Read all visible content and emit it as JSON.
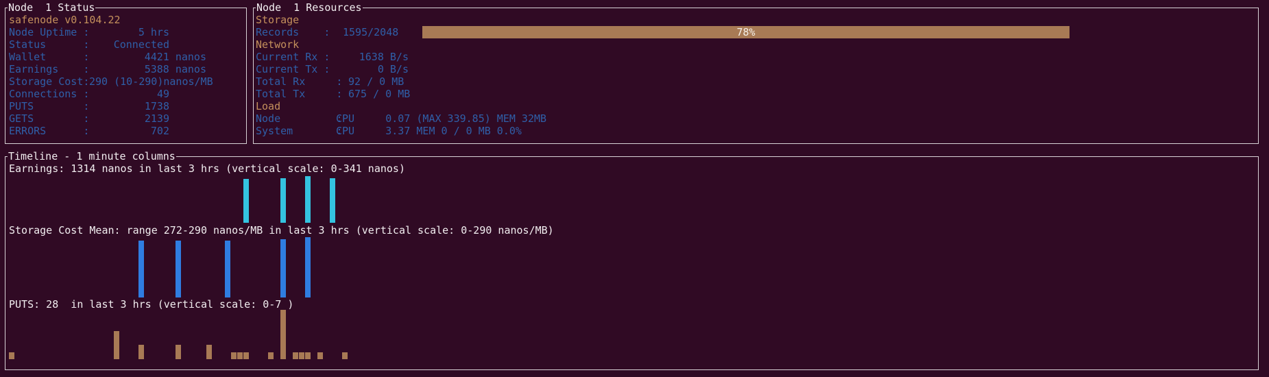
{
  "status_panel": {
    "title": "Node  1 Status",
    "version": "safenode v0.104.22",
    "rows": [
      {
        "label": "Node Uptime :",
        "value": "5 hrs"
      },
      {
        "label": "Status      :",
        "value": "Connected"
      },
      {
        "label": "Wallet      :",
        "value": "4421 nanos"
      },
      {
        "label": "Earnings    :",
        "value": "5388 nanos"
      },
      {
        "label": "Storage Cost:",
        "value": "290 (10-290)nanos/MB"
      },
      {
        "label": "Connections :",
        "value": "49"
      },
      {
        "label": "PUTS        :",
        "value": "1738"
      },
      {
        "label": "GETS        :",
        "value": "2139"
      },
      {
        "label": "ERRORS      :",
        "value": "702"
      }
    ]
  },
  "resources_panel": {
    "title": "Node  1 Resources",
    "storage_heading": "Storage",
    "records_label": "Records    :",
    "records_value": "1595/2048",
    "records_percent_label": "78%",
    "records_fraction": 0.78,
    "network_heading": "Network",
    "network_rows": [
      {
        "label": "Current Rx :",
        "value": "1638 B/s"
      },
      {
        "label": "Current Tx :",
        "value": "0 B/s"
      },
      {
        "label": "Total Rx     :",
        "value": "92 / 0 MB"
      },
      {
        "label": "Total Tx     :",
        "value": "675 / 0 MB"
      }
    ],
    "load_heading": "Load",
    "load_rows": [
      {
        "label": "Node         :",
        "value": "CPU     0.07 (MAX 339.85) MEM 32MB"
      },
      {
        "label": "System       :",
        "value": "CPU     3.37 MEM 0 / 0 MB 0.0%"
      }
    ]
  },
  "timeline_panel": {
    "title": "Timeline - 1 minute columns",
    "earnings_heading": "Earnings: 1314 nanos in last 3 hrs (vertical scale: 0-341 nanos)",
    "storage_heading": "Storage Cost Mean: range 272-290 nanos/MB in last 3 hrs (vertical scale: 0-290 nanos/MB)",
    "puts_heading": "PUTS: 28  in last 3 hrs (vertical scale: 0-7 )"
  },
  "colors": {
    "background": "#300a24",
    "earnings_bar": "#34c3e0",
    "storage_bar": "#2f7de1",
    "puts_bar": "#a87a55",
    "gauge": "#a87a55",
    "label_blue": "#2f5fa8",
    "heading_orange": "#c4905c"
  },
  "chart_data": [
    {
      "type": "bar",
      "title": "Earnings",
      "x_unit": "minute column",
      "ylim": [
        0,
        341
      ],
      "points": [
        {
          "x": 38,
          "y": 322
        },
        {
          "x": 44,
          "y": 327
        },
        {
          "x": 48,
          "y": 341
        },
        {
          "x": 52,
          "y": 324
        }
      ]
    },
    {
      "type": "bar",
      "title": "Storage Cost Mean",
      "x_unit": "minute column",
      "ylim": [
        0,
        290
      ],
      "points": [
        {
          "x": 21,
          "y": 272
        },
        {
          "x": 27,
          "y": 272
        },
        {
          "x": 35,
          "y": 272
        },
        {
          "x": 44,
          "y": 281
        },
        {
          "x": 48,
          "y": 290
        }
      ]
    },
    {
      "type": "bar",
      "title": "PUTS",
      "x_unit": "minute column",
      "ylim": [
        0,
        7
      ],
      "points": [
        {
          "x": 0,
          "y": 1
        },
        {
          "x": 17,
          "y": 4
        },
        {
          "x": 21,
          "y": 2
        },
        {
          "x": 27,
          "y": 2
        },
        {
          "x": 32,
          "y": 2
        },
        {
          "x": 36,
          "y": 1
        },
        {
          "x": 37,
          "y": 1
        },
        {
          "x": 38,
          "y": 1
        },
        {
          "x": 42,
          "y": 1
        },
        {
          "x": 44,
          "y": 7
        },
        {
          "x": 46,
          "y": 1
        },
        {
          "x": 47,
          "y": 1
        },
        {
          "x": 48,
          "y": 1
        },
        {
          "x": 50,
          "y": 1
        },
        {
          "x": 54,
          "y": 1
        }
      ]
    }
  ]
}
